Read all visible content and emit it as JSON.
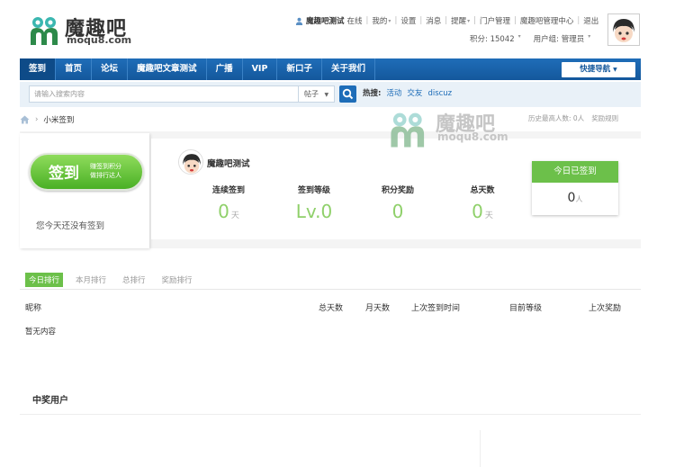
{
  "logo": {
    "title": "魔趣吧",
    "domain": "moqu8.com"
  },
  "toplinks": {
    "username": "魔趣吧测试",
    "status": "在线",
    "items": [
      "我的",
      "设置",
      "消息",
      "提醒",
      "门户管理",
      "魔趣吧管理中心",
      "退出"
    ]
  },
  "userinfo": {
    "points": "积分: 15042",
    "group": "用户组: 管理员"
  },
  "nav": {
    "items": [
      "签到",
      "首页",
      "论坛",
      "魔趣吧文章测试",
      "广播",
      "VIP",
      "新口子",
      "关于我们"
    ],
    "quicknav": "快捷导航"
  },
  "search": {
    "placeholder": "请输入搜索内容",
    "type": "帖子",
    "hot_label": "热搜:",
    "hot_items": [
      "活动",
      "交友",
      "discuz"
    ]
  },
  "breadcrumb": {
    "current": "小米签到"
  },
  "crumb_right": {
    "history": "历史最高人数: 0人",
    "rules": "奖励规则"
  },
  "watermark": {
    "title": "魔趣吧",
    "domain": "moqu8.com"
  },
  "sign": {
    "button": "签到",
    "button_sub1": "赚签到积分",
    "button_sub2": "做排行达人",
    "not_signed": "您今天还没有签到"
  },
  "profile": {
    "name": "魔趣吧测试"
  },
  "stats": [
    {
      "label": "连续签到",
      "value": "0",
      "unit": "天"
    },
    {
      "label": "签到等级",
      "value": "Lv.0",
      "unit": ""
    },
    {
      "label": "积分奖励",
      "value": "0",
      "unit": ""
    },
    {
      "label": "总天数",
      "value": "0",
      "unit": "天"
    }
  ],
  "today": {
    "title": "今日已签到",
    "count": "0",
    "unit": "人"
  },
  "ranking": {
    "tabs": [
      "今日排行",
      "本月排行",
      "总排行",
      "奖励排行"
    ],
    "columns": [
      "昵称",
      "总天数",
      "月天数",
      "上次签到时间",
      "目前等级",
      "上次奖励"
    ],
    "empty": "暂无内容"
  },
  "winners": {
    "title": "中奖用户"
  },
  "colors": {
    "nav": "#14589c",
    "accent": "#6cc04a",
    "link": "#1e6db8"
  }
}
